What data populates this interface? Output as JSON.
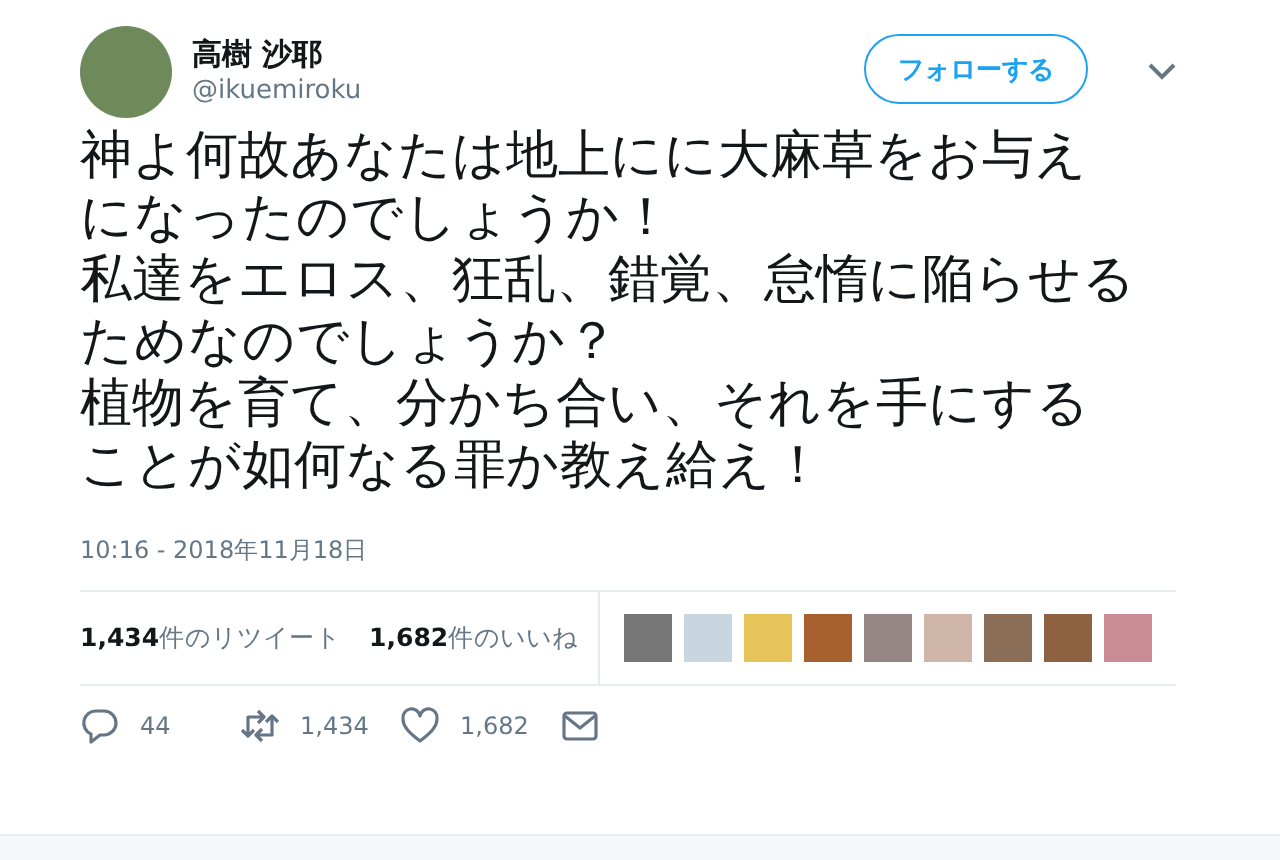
{
  "author": {
    "name": "高樹 沙耶",
    "handle": "@ikuemiroku"
  },
  "follow_button": "フォローする",
  "tweet": {
    "paragraphs": [
      "神よ何故あなたは地上にに大麻草をお与えになったのでしょうか！",
      "私達をエロス、狂乱、錯覚、怠惰に陥らせるためなのでしょうか？",
      "植物を育て、分かち合い、それを手にすることが如何なる罪か教え給え！"
    ],
    "timestamp": "10:16 - 2018年11月18日"
  },
  "stats": [
    "**1,434**件のリツイート",
    "**1,682**件のいいね"
  ],
  "actions": [
    {
      "kind": "reply",
      "count": "44"
    },
    {
      "kind": "retweet",
      "count": "1,434"
    },
    {
      "kind": "like",
      "count": "1,682"
    },
    {
      "kind": "message"
    }
  ]
}
